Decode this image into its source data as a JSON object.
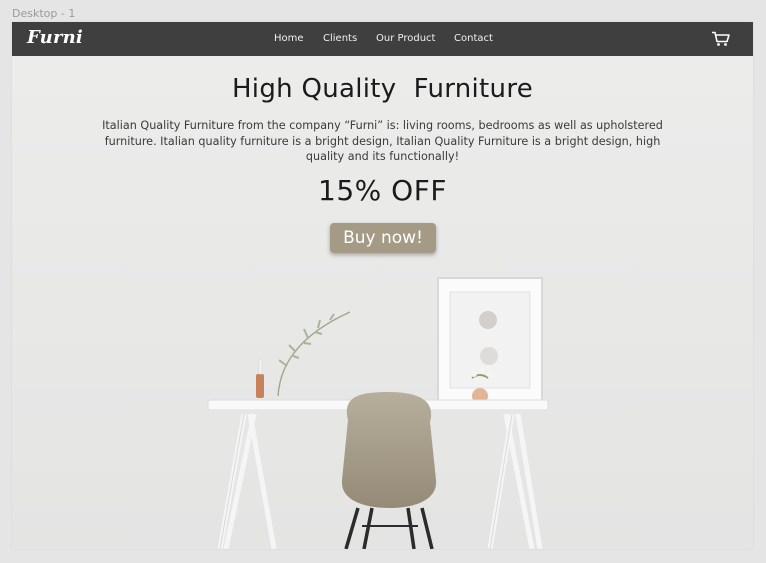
{
  "frame_label": "Desktop - 1",
  "navbar": {
    "logo": "Furni",
    "links": [
      "Home",
      "Clients",
      "Our Product",
      "Contact"
    ],
    "cart_icon": "cart-icon"
  },
  "hero": {
    "title": "High Quality  Furniture",
    "description": "Italian Quality Furniture from the company “Furni” is: living rooms, bedrooms as well as upholstered furniture. Italian quality furniture is a bright design, Italian Quality Furniture is a bright design, high quality and its functionally!",
    "discount": "15% OFF",
    "cta_label": "Buy now!"
  },
  "colors": {
    "navbar_bg": "#3f3f3f",
    "button_bg": "#a59a85",
    "wall": "#ebebea"
  }
}
